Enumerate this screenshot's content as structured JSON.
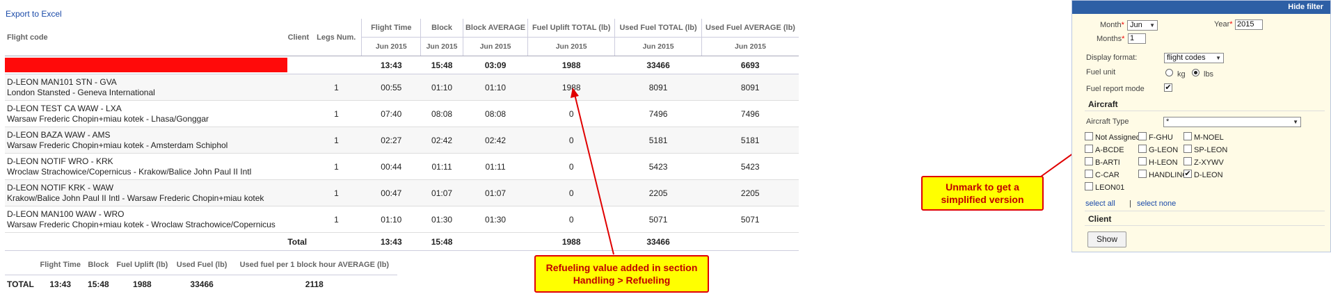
{
  "export_link": "Export to Excel",
  "table": {
    "headers": {
      "flight_code": "Flight code",
      "client": "Client",
      "legs": "Legs Num.",
      "flight_time": "Flight Time",
      "block": "Block",
      "block_avg": "Block AVERAGE",
      "fuel_uplift": "Fuel Uplift TOTAL (lb)",
      "used_fuel": "Used Fuel TOTAL (lb)",
      "used_fuel_avg": "Used Fuel AVERAGE (lb)"
    },
    "period": "Jun 2015",
    "summary": {
      "flight_time": "13:43",
      "block": "15:48",
      "block_avg": "03:09",
      "fuel_uplift": "1988",
      "used_fuel": "33466",
      "used_fuel_avg": "6693",
      "bar_color": "#ff0a0a"
    },
    "rows": [
      {
        "line1": "D-LEON MAN101 STN - GVA",
        "line2": "London Stansted - Geneva International",
        "legs": "1",
        "flight_time": "00:55",
        "block": "01:10",
        "block_avg": "01:10",
        "fuel_uplift": "1988",
        "used_fuel": "8091",
        "used_fuel_avg": "8091"
      },
      {
        "line1": "D-LEON TEST CA WAW - LXA",
        "line2": "Warsaw Frederic Chopin+miau kotek - Lhasa/Gonggar",
        "legs": "1",
        "flight_time": "07:40",
        "block": "08:08",
        "block_avg": "08:08",
        "fuel_uplift": "0",
        "used_fuel": "7496",
        "used_fuel_avg": "7496"
      },
      {
        "line1": "D-LEON BAZA WAW - AMS",
        "line2": "Warsaw Frederic Chopin+miau kotek - Amsterdam Schiphol",
        "legs": "1",
        "flight_time": "02:27",
        "block": "02:42",
        "block_avg": "02:42",
        "fuel_uplift": "0",
        "used_fuel": "5181",
        "used_fuel_avg": "5181"
      },
      {
        "line1": "D-LEON NOTIF WRO - KRK",
        "line2": "Wroclaw Strachowice/Copernicus - Krakow/Balice John Paul II Intl",
        "legs": "1",
        "flight_time": "00:44",
        "block": "01:11",
        "block_avg": "01:11",
        "fuel_uplift": "0",
        "used_fuel": "5423",
        "used_fuel_avg": "5423"
      },
      {
        "line1": "D-LEON NOTIF KRK - WAW",
        "line2": "Krakow/Balice John Paul II Intl - Warsaw Frederic Chopin+miau kotek",
        "legs": "1",
        "flight_time": "00:47",
        "block": "01:07",
        "block_avg": "01:07",
        "fuel_uplift": "0",
        "used_fuel": "2205",
        "used_fuel_avg": "2205"
      },
      {
        "line1": "D-LEON MAN100 WAW - WRO",
        "line2": "Warsaw Frederic Chopin+miau kotek - Wroclaw Strachowice/Copernicus",
        "legs": "1",
        "flight_time": "01:10",
        "block": "01:30",
        "block_avg": "01:30",
        "fuel_uplift": "0",
        "used_fuel": "5071",
        "used_fuel_avg": "5071"
      }
    ],
    "total": {
      "label": "Total",
      "flight_time": "13:43",
      "block": "15:48",
      "fuel_uplift": "1988",
      "used_fuel": "33466"
    }
  },
  "summary_table": {
    "headers": {
      "flight_time": "Flight Time",
      "block": "Block",
      "fuel_uplift": "Fuel Uplift (lb)",
      "used_fuel": "Used Fuel (lb)",
      "per_hour": "Used fuel per 1 block hour AVERAGE (lb)"
    },
    "row": {
      "label": "TOTAL",
      "flight_time": "13:43",
      "block": "15:48",
      "fuel_uplift": "1988",
      "used_fuel": "33466",
      "per_hour": "2118"
    }
  },
  "callouts": {
    "refuel": {
      "line1": "Refueling value added in section",
      "line2": "Handling > Refueling"
    },
    "unmark": {
      "line1": "Unmark to get a",
      "line2": "simplified version"
    },
    "color_border": "#e00000",
    "color_fill": "#ffff00"
  },
  "filter": {
    "hide": "Hide filter",
    "month_label": "Month",
    "month_value": "Jun",
    "year_label": "Year",
    "year_value": "2015",
    "months_label": "Months",
    "months_value": "1",
    "display_format_label": "Display format:",
    "display_format_value": "flight codes",
    "fuel_unit_label": "Fuel unit",
    "fuel_unit_kg": "kg",
    "fuel_unit_lbs": "lbs",
    "fuel_unit_selected": "lbs",
    "fuel_report_label": "Fuel report mode",
    "fuel_report_checked": true,
    "aircraft_section": "Aircraft",
    "aircraft_type_label": "Aircraft Type",
    "aircraft_type_value": "*",
    "aircraft": [
      {
        "label": "Not Assigned",
        "checked": false
      },
      {
        "label": "F-GHU",
        "checked": false
      },
      {
        "label": "M-NOEL",
        "checked": false
      },
      {
        "label": "A-BCDE",
        "checked": false
      },
      {
        "label": "G-LEON",
        "checked": false
      },
      {
        "label": "SP-LEON",
        "checked": false
      },
      {
        "label": "B-ARTI",
        "checked": false
      },
      {
        "label": "H-LEON",
        "checked": false
      },
      {
        "label": "Z-XYWV",
        "checked": false
      },
      {
        "label": "C-CAR",
        "checked": false
      },
      {
        "label": "HANDLING",
        "checked": false
      },
      {
        "label": "D-LEON",
        "checked": true
      },
      {
        "label": "LEON01",
        "checked": false
      }
    ],
    "select_all": "select all",
    "divider": "|",
    "select_none": "select none",
    "client_section": "Client",
    "show_button": "Show",
    "header_color": "#2d5fa5"
  }
}
